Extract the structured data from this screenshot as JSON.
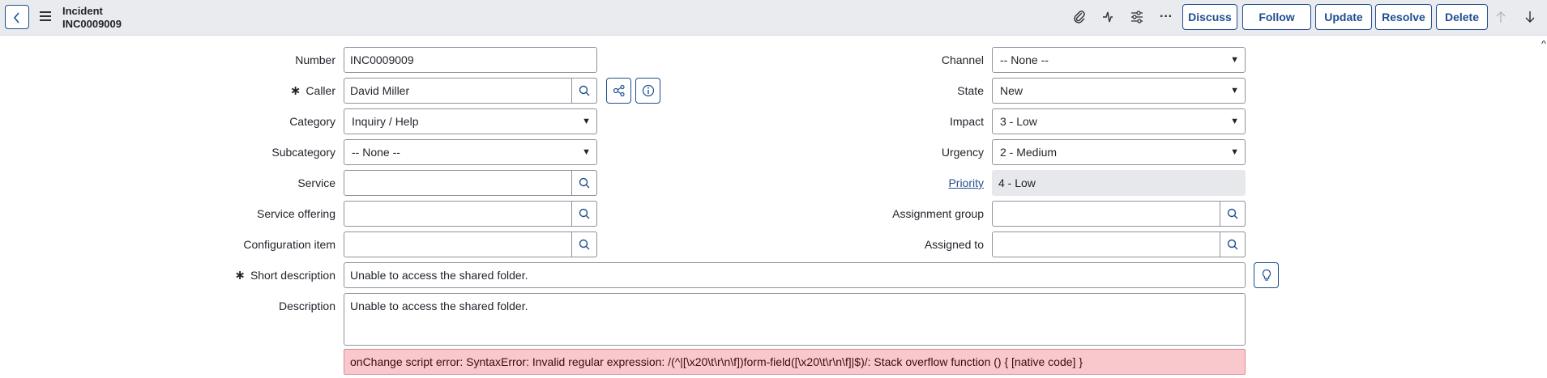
{
  "header": {
    "title": "Incident",
    "number": "INC0009009",
    "buttons": {
      "discuss": "Discuss",
      "follow": "Follow",
      "update": "Update",
      "resolve": "Resolve",
      "delete": "Delete"
    },
    "icons": [
      "paperclip-icon",
      "activity-icon",
      "settings-sliders-icon",
      "more-icon",
      "arrow-up-icon",
      "arrow-down-icon"
    ]
  },
  "form": {
    "number": {
      "label": "Number",
      "value": "INC0009009"
    },
    "caller": {
      "label": "Caller",
      "value": "David Miller",
      "required": "∗"
    },
    "category": {
      "label": "Category",
      "value": "Inquiry / Help"
    },
    "subcategory": {
      "label": "Subcategory",
      "value": "-- None --"
    },
    "service": {
      "label": "Service",
      "value": ""
    },
    "service_offering": {
      "label": "Service offering",
      "value": ""
    },
    "configuration_item": {
      "label": "Configuration item",
      "value": ""
    },
    "channel": {
      "label": "Channel",
      "value": "-- None --"
    },
    "state": {
      "label": "State",
      "value": "New"
    },
    "impact": {
      "label": "Impact",
      "value": "3 - Low"
    },
    "urgency": {
      "label": "Urgency",
      "value": "2 - Medium"
    },
    "priority": {
      "label": "Priority",
      "value": "4 - Low"
    },
    "assignment_group": {
      "label": "Assignment group",
      "value": ""
    },
    "assigned_to": {
      "label": "Assigned to",
      "value": ""
    },
    "short_description": {
      "label": "Short description",
      "value": "Unable to access the shared folder.",
      "required": "∗"
    },
    "description": {
      "label": "Description",
      "value": "Unable to access the shared folder."
    },
    "error_message": "onChange script error: SyntaxError: Invalid regular expression: /(^|[\\x20\\t\\r\\n\\f])form-field([\\x20\\t\\r\\n\\f]|$)/: Stack overflow function () { [native code] }"
  },
  "colors": {
    "accent": "#1f4f8f",
    "header_bg": "#e9ebee",
    "error_bg": "#f9c8cd",
    "readonly_bg": "#e6e8eb"
  }
}
